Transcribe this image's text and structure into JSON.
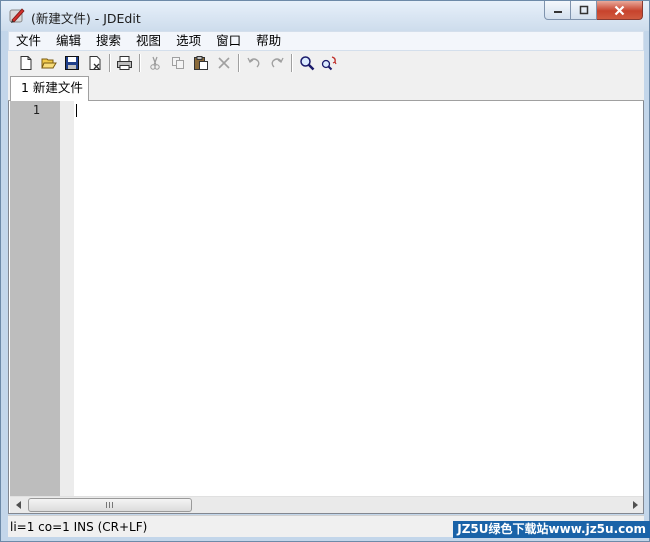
{
  "window": {
    "title": "(新建文件) - JDEdit"
  },
  "menu": {
    "items": [
      "文件",
      "编辑",
      "搜索",
      "视图",
      "选项",
      "窗口",
      "帮助"
    ]
  },
  "toolbar": {
    "icons": [
      "new-file-icon",
      "open-folder-icon",
      "save-icon",
      "close-file-icon",
      "print-icon",
      "cut-icon",
      "copy-icon",
      "paste-icon",
      "delete-icon",
      "undo-icon",
      "redo-icon",
      "find-icon",
      "replace-icon"
    ]
  },
  "tabs": [
    {
      "label": "1 新建文件",
      "active": true
    }
  ],
  "editor": {
    "line_numbers": [
      "1"
    ],
    "content": ""
  },
  "status": {
    "text": "li=1 co=1 INS (CR+LF)",
    "watermark": "JZ5U绿色下载站www.jz5u.com"
  },
  "colors": {
    "gutter": "#bdbdbd",
    "close_button": "#c7432d",
    "watermark_bg": "#1a63a8"
  }
}
